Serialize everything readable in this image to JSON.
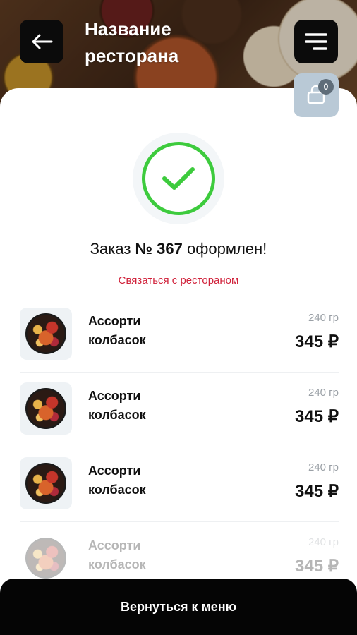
{
  "header": {
    "title_line1": "Название",
    "title_line2": "ресторана",
    "back_icon": "arrow-left-icon",
    "menu_icon": "menu-icon"
  },
  "cart": {
    "icon": "bag-icon",
    "count": "0"
  },
  "status": {
    "icon": "checkmark-icon",
    "order_prefix": "Заказ",
    "order_number": "№ 367",
    "order_suffix": "оформлен!",
    "contact_link": "Связаться с рестораном"
  },
  "items": [
    {
      "name_line1": "Ассорти",
      "name_line2": "колбасок",
      "weight": "240 гр",
      "price": "345 ₽"
    },
    {
      "name_line1": "Ассорти",
      "name_line2": "колбасок",
      "weight": "240 гр",
      "price": "345 ₽"
    },
    {
      "name_line1": "Ассорти",
      "name_line2": "колбасок",
      "weight": "240 гр",
      "price": "345 ₽"
    },
    {
      "name_line1": "Ассорти",
      "name_line2": "колбасок",
      "weight": "240 гр",
      "price": "345 ₽"
    }
  ],
  "footer": {
    "button_label": "Вернуться к меню"
  },
  "colors": {
    "accent_green": "#3dcb3d",
    "link_red": "#d0213a",
    "cart_bg": "#b9c9d6",
    "button_bg": "#050505"
  }
}
